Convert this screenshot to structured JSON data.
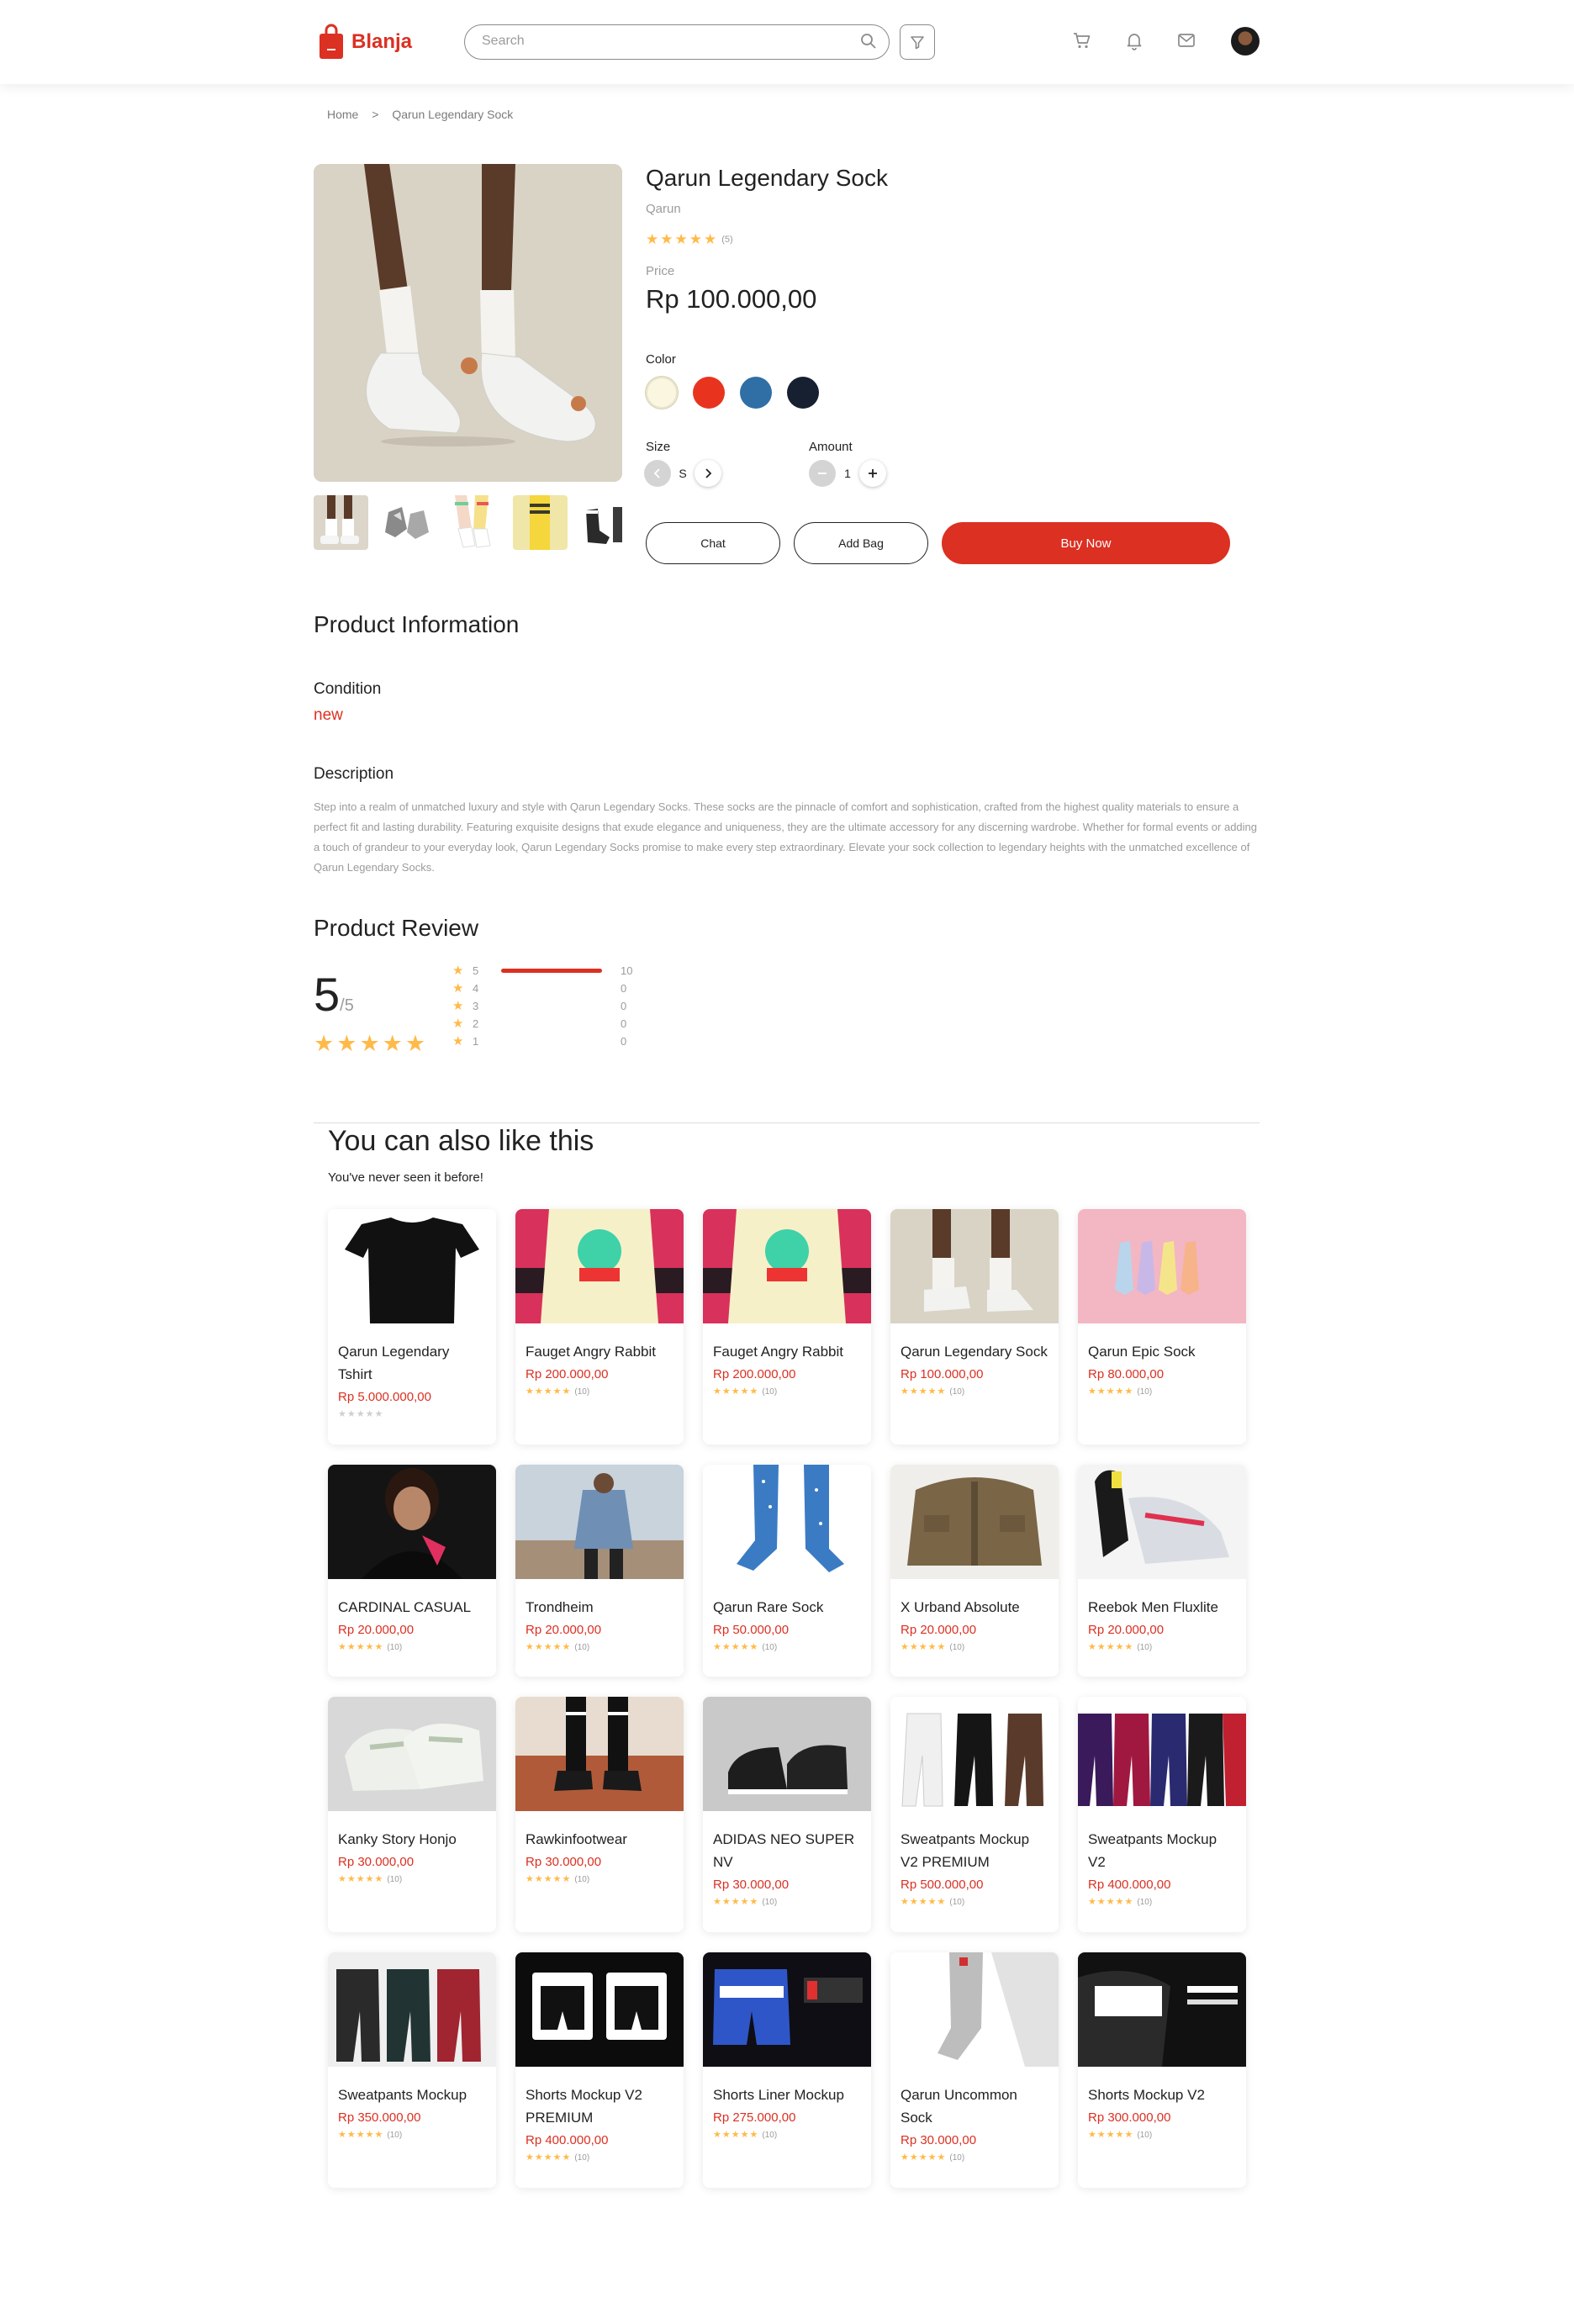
{
  "brand": {
    "name": "Blanja"
  },
  "search": {
    "placeholder": "Search"
  },
  "nav_icons": [
    "cart-icon",
    "bell-icon",
    "mail-icon"
  ],
  "breadcrumb": {
    "home": "Home",
    "separator": ">",
    "current": "Qarun Legendary Sock"
  },
  "product": {
    "title": "Qarun Legendary Sock",
    "brand": "Qarun",
    "rating": 5,
    "rating_count": "(5)",
    "price_label": "Price",
    "price": "Rp 100.000,00",
    "color_label": "Color",
    "colors": [
      "#FBF6DF",
      "#E8341F",
      "#2F6FA6",
      "#162030"
    ],
    "size_label": "Size",
    "size_value": "S",
    "amount_label": "Amount",
    "amount_value": "1",
    "chat_label": "Chat",
    "addbag_label": "Add Bag",
    "buy_label": "Buy Now"
  },
  "info": {
    "title": "Product Information",
    "condition_label": "Condition",
    "condition_value": "new",
    "description_label": "Description",
    "description": "Step into a realm of unmatched luxury and style with Qarun Legendary Socks. These socks are the pinnacle of comfort and sophistication, crafted from the highest quality materials to ensure a perfect fit and lasting durability. Featuring exquisite designs that exude elegance and uniqueness, they are the ultimate accessory for any discerning wardrobe. Whether for formal events or adding a touch of grandeur to your everyday look, Qarun Legendary Socks promise to make every step extraordinary. Elevate your sock collection to legendary heights with the unmatched excellence of Qarun Legendary Socks."
  },
  "review": {
    "title": "Product Review",
    "score": "5",
    "score_max": "/5",
    "distribution": [
      {
        "stars": "5",
        "count": "10",
        "fraction": 1.0
      },
      {
        "stars": "4",
        "count": "0",
        "fraction": 0
      },
      {
        "stars": "3",
        "count": "0",
        "fraction": 0
      },
      {
        "stars": "2",
        "count": "0",
        "fraction": 0
      },
      {
        "stars": "1",
        "count": "0",
        "fraction": 0
      }
    ]
  },
  "recommend": {
    "title": "You can also like this",
    "subtitle": "You've never seen it before!",
    "products": [
      {
        "name": "Qarun Legendary Tshirt",
        "price": "Rp 5.000.000,00",
        "rating": 0,
        "count": ""
      },
      {
        "name": "Fauget Angry Rabbit",
        "price": "Rp 200.000,00",
        "rating": 5,
        "count": "(10)"
      },
      {
        "name": "Fauget Angry Rabbit",
        "price": "Rp 200.000,00",
        "rating": 5,
        "count": "(10)"
      },
      {
        "name": "Qarun Legendary Sock",
        "price": "Rp 100.000,00",
        "rating": 5,
        "count": "(10)"
      },
      {
        "name": "Qarun Epic Sock",
        "price": "Rp 80.000,00",
        "rating": 5,
        "count": "(10)"
      },
      {
        "name": "CARDINAL CASUAL",
        "price": "Rp 20.000,00",
        "rating": 5,
        "count": "(10)"
      },
      {
        "name": "Trondheim",
        "price": "Rp 20.000,00",
        "rating": 5,
        "count": "(10)"
      },
      {
        "name": "Qarun Rare Sock",
        "price": "Rp 50.000,00",
        "rating": 5,
        "count": "(10)"
      },
      {
        "name": "X Urband Absolute",
        "price": "Rp 20.000,00",
        "rating": 5,
        "count": "(10)"
      },
      {
        "name": "Reebok Men Fluxlite",
        "price": "Rp 20.000,00",
        "rating": 5,
        "count": "(10)"
      },
      {
        "name": "Kanky Story Honjo",
        "price": "Rp 30.000,00",
        "rating": 5,
        "count": "(10)"
      },
      {
        "name": "Rawkinfootwear",
        "price": "Rp 30.000,00",
        "rating": 5,
        "count": "(10)"
      },
      {
        "name": "ADIDAS NEO SUPER NV",
        "price": "Rp 30.000,00",
        "rating": 5,
        "count": "(10)"
      },
      {
        "name": "Sweatpants Mockup V2 PREMIUM",
        "price": "Rp 500.000,00",
        "rating": 5,
        "count": "(10)"
      },
      {
        "name": "Sweatpants Mockup V2",
        "price": "Rp 400.000,00",
        "rating": 5,
        "count": "(10)"
      },
      {
        "name": "Sweatpants Mockup",
        "price": "Rp 350.000,00",
        "rating": 5,
        "count": "(10)"
      },
      {
        "name": "Shorts Mockup V2 PREMIUM",
        "price": "Rp 400.000,00",
        "rating": 5,
        "count": "(10)"
      },
      {
        "name": "Shorts Liner Mockup",
        "price": "Rp 275.000,00",
        "rating": 5,
        "count": "(10)"
      },
      {
        "name": "Qarun Uncommon Sock",
        "price": "Rp 30.000,00",
        "rating": 5,
        "count": "(10)"
      },
      {
        "name": "Shorts Mockup V2",
        "price": "Rp 300.000,00",
        "rating": 5,
        "count": "(10)"
      }
    ]
  }
}
